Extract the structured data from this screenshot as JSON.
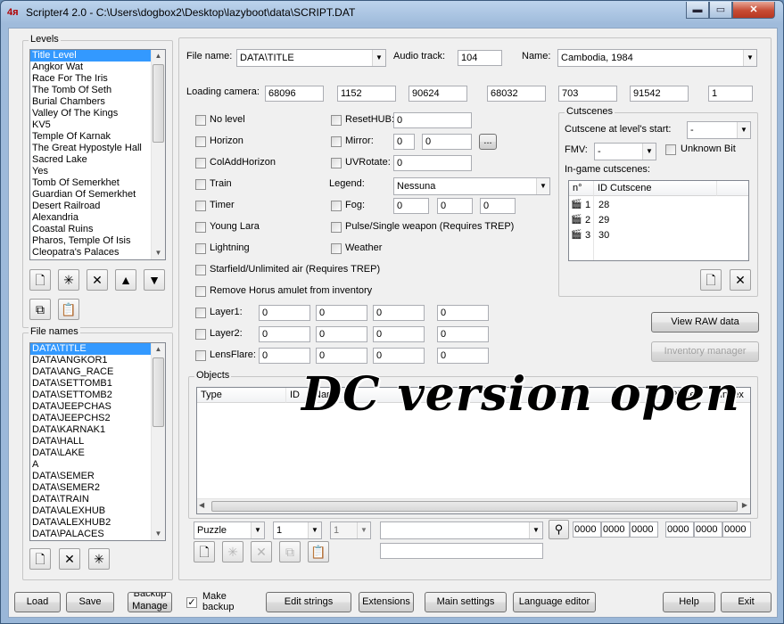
{
  "window": {
    "title": "Scripter4 2.0 - C:\\Users\\dogbox2\\Desktop\\lazyboot\\data\\SCRIPT.DAT",
    "icon": "app-logo-icon",
    "controls": {
      "minimize": "▬",
      "maximize": "▭",
      "close": "✕"
    }
  },
  "levels": {
    "label": "Levels",
    "items": [
      "Title Level",
      "Angkor Wat",
      "Race For The Iris",
      "The Tomb Of Seth",
      "Burial Chambers",
      "Valley Of The Kings",
      "KV5",
      "Temple Of Karnak",
      "The Great Hypostyle Hall",
      "Sacred Lake",
      "Yes",
      "Tomb Of Semerkhet",
      "Guardian Of Semerkhet",
      "Desert Railroad",
      "Alexandria",
      "Coastal Ruins",
      "Pharos, Temple Of Isis",
      "Cleopatra's Palaces"
    ],
    "selected_index": 0,
    "toolbar": [
      "new-icon",
      "add-icon",
      "delete-icon",
      "move-up-icon",
      "move-down-icon"
    ],
    "toolbar2": [
      "copy-icon",
      "paste-icon"
    ]
  },
  "filenames": {
    "label": "File names",
    "items": [
      "DATA\\TITLE",
      "DATA\\ANGKOR1",
      "DATA\\ANG_RACE",
      "DATA\\SETTOMB1",
      "DATA\\SETTOMB2",
      "DATA\\JEEPCHAS",
      "DATA\\JEEPCHS2",
      "DATA\\KARNAK1",
      "DATA\\HALL",
      "DATA\\LAKE",
      "A",
      "DATA\\SEMER",
      "DATA\\SEMER2",
      "DATA\\TRAIN",
      "DATA\\ALEXHUB",
      "DATA\\ALEXHUB2",
      "DATA\\PALACES"
    ],
    "selected_index": 0,
    "toolbar": [
      "new-icon",
      "delete-icon",
      "add-icon"
    ]
  },
  "level": {
    "file_name_label": "File name:",
    "file_name": "DATA\\TITLE",
    "audio_label": "Audio track:",
    "audio": "104",
    "name_label": "Name:",
    "name": "Cambodia, 1984",
    "camera_label": "Loading camera:",
    "camera": [
      "68096",
      "1152",
      "90624",
      "68032",
      "703",
      "91542",
      "1"
    ]
  },
  "flags": {
    "no_level": "No level",
    "horizon": "Horizon",
    "col_add_horizon": "ColAddHorizon",
    "train": "Train",
    "timer": "Timer",
    "young_lara": "Young Lara",
    "lightning": "Lightning",
    "starfield": "Starfield/Unlimited air (Requires TREP)",
    "remove_horus": "Remove Horus amulet from inventory",
    "layer1": "Layer1:",
    "layer2": "Layer2:",
    "lensflare": "LensFlare:",
    "resethub": "ResetHUB:",
    "mirror": "Mirror:",
    "uvrotate": "UVRotate:",
    "legend": "Legend:",
    "fog": "Fog:",
    "pulse": "Pulse/Single weapon (Requires TREP)",
    "weather": "Weather"
  },
  "values": {
    "resethub": "0",
    "mirror": [
      "0",
      "0"
    ],
    "mirror_button": "...",
    "uvrotate": "0",
    "legend": "Nessuna",
    "fog": [
      "0",
      "0",
      "0"
    ],
    "layer1": [
      "0",
      "0",
      "0",
      "0"
    ],
    "layer2": [
      "0",
      "0",
      "0",
      "0"
    ],
    "lensflare": [
      "0",
      "0",
      "0",
      "0"
    ]
  },
  "cutscenes": {
    "label": "Cutscenes",
    "start_label": "Cutscene at level's start:",
    "start_value": "-",
    "fmv_label": "FMV:",
    "fmv_value": "-",
    "unknown_bit": "Unknown Bit",
    "ingame_label": "In-game cutscenes:",
    "col_n": "n°",
    "col_id": "ID Cutscene",
    "rows": [
      {
        "n": "1",
        "id": "28"
      },
      {
        "n": "2",
        "id": "29"
      },
      {
        "n": "3",
        "id": "30"
      }
    ],
    "toolbar": [
      "new-icon",
      "delete-icon"
    ]
  },
  "right_buttons": {
    "view_raw": "View RAW data",
    "inventory": "Inventory manager"
  },
  "objects": {
    "label": "Objects",
    "columns": [
      "Type",
      "ID",
      "Name",
      "Piece",
      "Index"
    ],
    "type_value": "Puzzle",
    "num1": "1",
    "num2": "1",
    "name_value": "",
    "hex": [
      "0000",
      "0000",
      "0000",
      "0000",
      "0000",
      "0000"
    ],
    "toolbar": [
      "new-icon",
      "add-icon",
      "delete-icon",
      "copy-icon",
      "paste-icon"
    ]
  },
  "overlay_text": "DC version open",
  "bottom": {
    "load": "Load",
    "save": "Save",
    "backup_manage_1": "Backup",
    "backup_manage_2": "Manage",
    "make_backup_1": "Make",
    "make_backup_2": "backup",
    "edit_strings": "Edit strings",
    "extensions": "Extensions",
    "main_settings": "Main settings",
    "language_editor": "Language editor",
    "help": "Help",
    "exit": "Exit"
  }
}
